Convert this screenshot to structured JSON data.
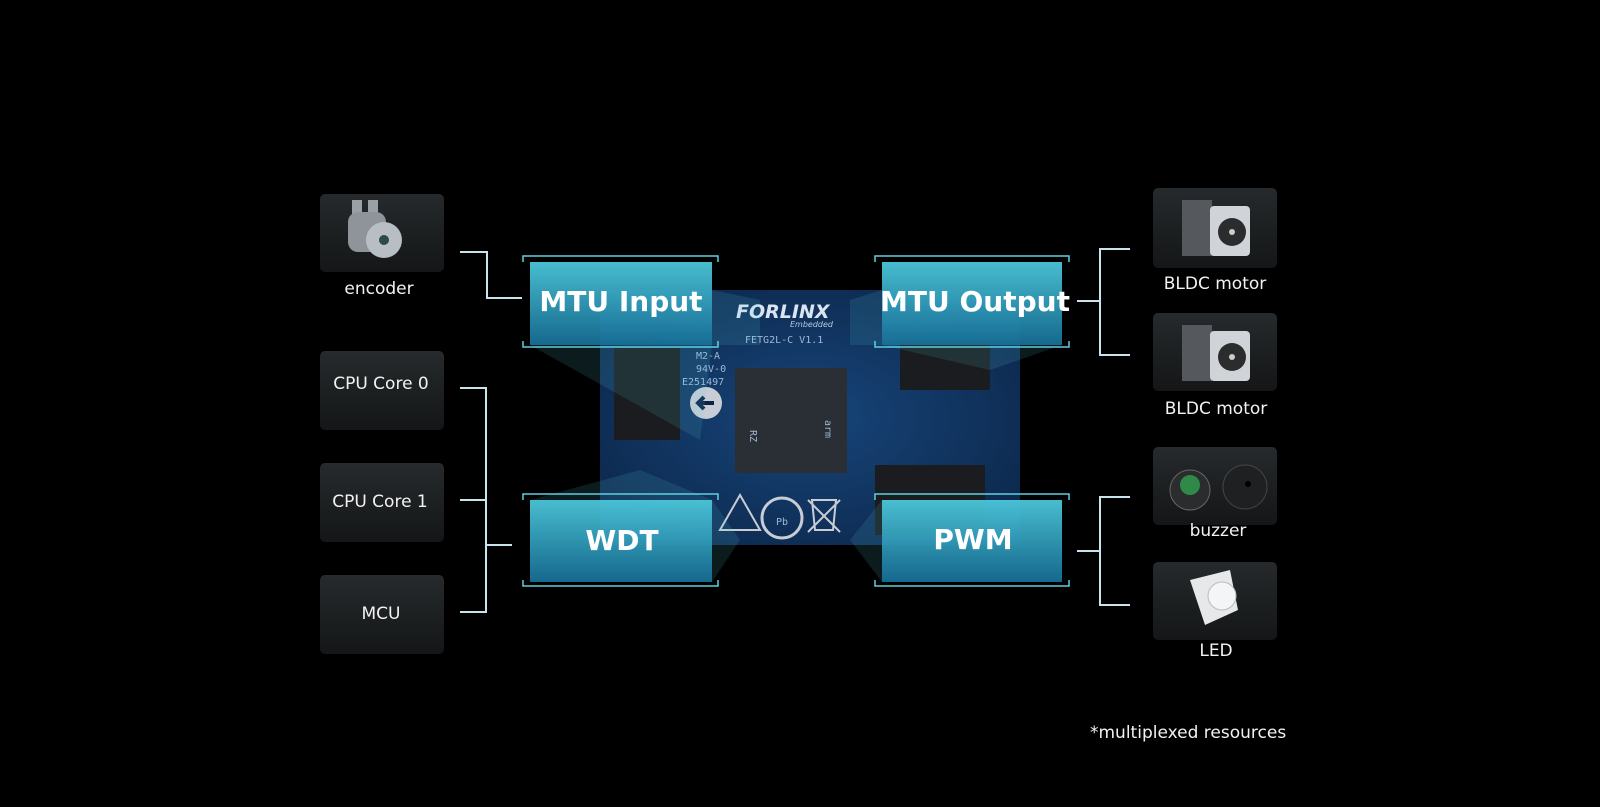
{
  "board": {
    "brand": "FORLINX",
    "brand_sub": "Embedded",
    "model": "FETG2L-C  V1.1",
    "chip_mark": "arm",
    "chip_text": "RZ",
    "cert1": "M2-A",
    "cert2": "94V-0",
    "cert3": "E251497"
  },
  "blocks": {
    "mtu_input": "MTU Input",
    "mtu_output": "MTU Output",
    "wdt": "WDT",
    "pwm": "PWM"
  },
  "left": {
    "encoder": "encoder",
    "cpu0": "CPU Core 0",
    "cpu1": "CPU Core 1",
    "mcu": "MCU"
  },
  "right": {
    "bldc1": "BLDC motor",
    "bldc2": "BLDC motor",
    "buzzer": "buzzer",
    "led": "LED"
  },
  "footnote": "*multiplexed resources",
  "colors": {
    "background": "#000000",
    "block": "#2fa6c4",
    "board": "#0f2e5a",
    "line": "#c8e4ec"
  }
}
